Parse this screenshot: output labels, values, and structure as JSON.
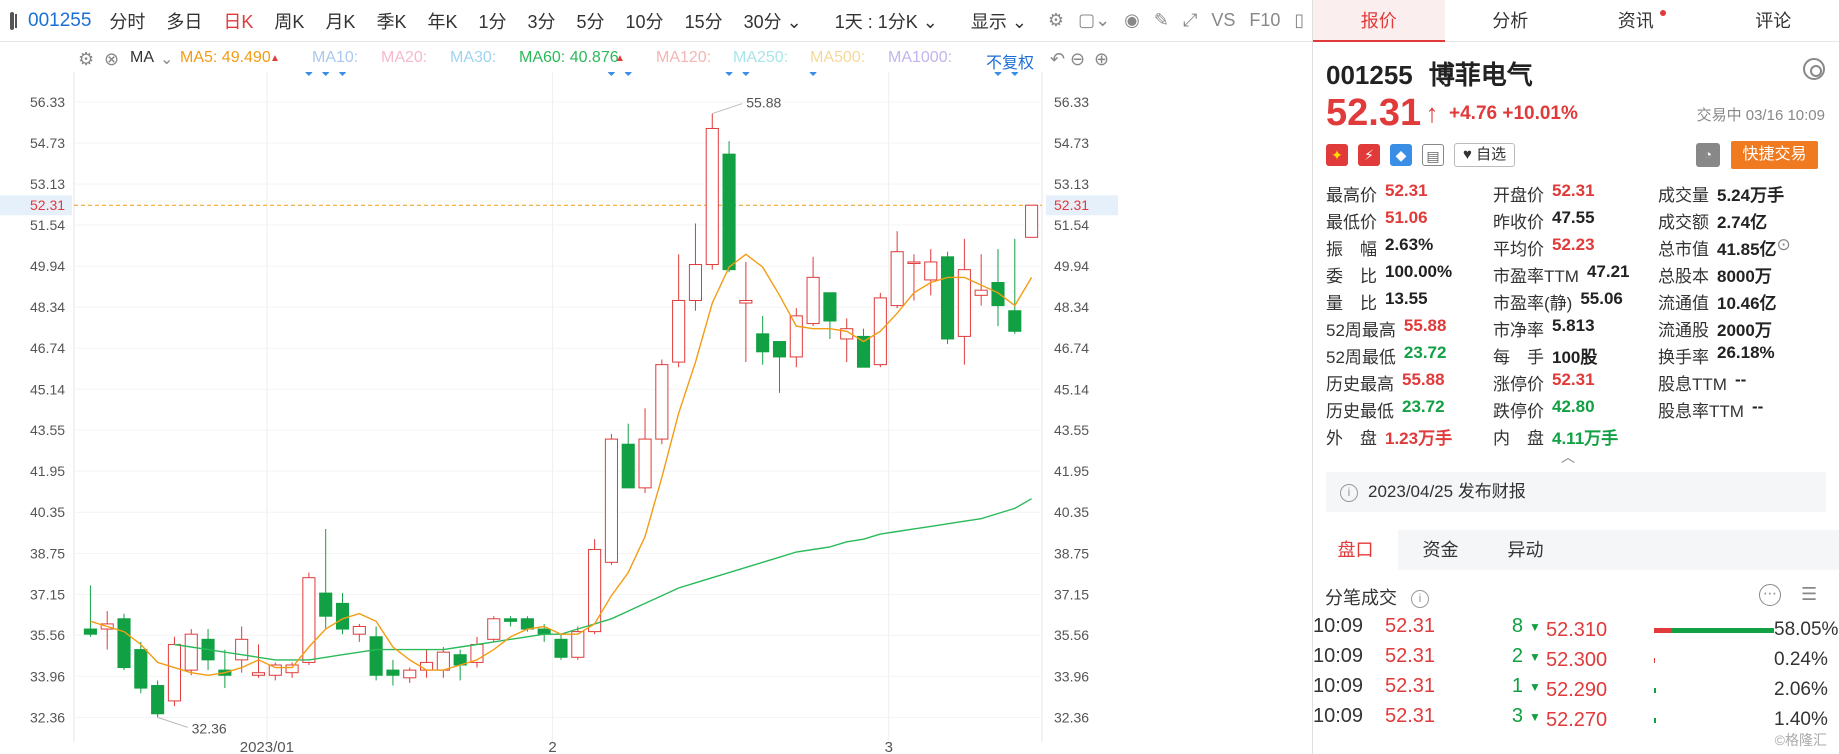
{
  "toolbar": {
    "code": "001255",
    "periods": [
      "分时",
      "多日",
      "日K",
      "周K",
      "月K",
      "季K",
      "年K",
      "1分",
      "3分",
      "5分",
      "10分",
      "15分",
      "30分 ⌄"
    ],
    "active_index": 2,
    "range": "1天 : 1分K ⌄",
    "display": "显示 ⌄",
    "tools": [
      "gear-icon",
      "square-icon",
      "camera-icon",
      "pen-icon",
      "expand-icon",
      "vs-icon",
      "f10-icon",
      "sidebar-icon"
    ],
    "tool_labels": {
      "vs": "VS",
      "f10": "F10"
    }
  },
  "ma_row": {
    "ma_label": "MA",
    "ma5": "MA5: 49.490",
    "ma10": "MA10:",
    "ma20": "MA20:",
    "ma30": "MA30:",
    "ma60": "MA60: 40.876",
    "ma120": "MA120:",
    "ma250": "MA250:",
    "ma500": "MA500:",
    "ma1000": "MA1000:",
    "adjust": "不复权"
  },
  "colors": {
    "up": "#e03a3a",
    "down": "#11a043",
    "ma5": "#f39c12",
    "ma60": "#2bba5a",
    "accent": "#1a6fd6",
    "ma10": "#aac8ee",
    "ma20": "#f5b8cf",
    "ma30": "#9fd4ee",
    "ma120": "#f4b5b5",
    "ma250": "#a8e5e8",
    "ma500": "#f7d89b",
    "ma1000": "#c3b4ee"
  },
  "chart_data": {
    "type": "candlestick",
    "x_tick_labels": [
      "2023/01",
      "2",
      "3"
    ],
    "y_tick_labels": [
      "56.33",
      "54.73",
      "53.13",
      "51.54",
      "49.94",
      "48.34",
      "46.74",
      "45.14",
      "43.55",
      "41.95",
      "40.35",
      "38.75",
      "37.15",
      "35.56",
      "33.96",
      "32.36"
    ],
    "ylim": [
      31.4,
      57.5
    ],
    "last_price_label": "52.31",
    "high_annotation": "55.88",
    "low_annotation": "32.36",
    "candles": [
      {
        "o": 35.8,
        "h": 37.5,
        "l": 35.5,
        "c": 35.6
      },
      {
        "o": 35.8,
        "h": 36.5,
        "l": 35.0,
        "c": 36.0
      },
      {
        "o": 36.2,
        "h": 36.4,
        "l": 34.2,
        "c": 34.3
      },
      {
        "o": 35.0,
        "h": 35.3,
        "l": 33.3,
        "c": 33.5
      },
      {
        "o": 33.6,
        "h": 33.8,
        "l": 32.36,
        "c": 32.5
      },
      {
        "o": 33.0,
        "h": 35.5,
        "l": 32.8,
        "c": 35.2
      },
      {
        "o": 34.2,
        "h": 35.8,
        "l": 34.0,
        "c": 35.6
      },
      {
        "o": 35.4,
        "h": 35.8,
        "l": 34.2,
        "c": 34.6
      },
      {
        "o": 34.2,
        "h": 35.0,
        "l": 33.5,
        "c": 34.0
      },
      {
        "o": 34.6,
        "h": 35.9,
        "l": 34.1,
        "c": 35.4
      },
      {
        "o": 34.0,
        "h": 35.2,
        "l": 33.9,
        "c": 34.1
      },
      {
        "o": 34.0,
        "h": 34.5,
        "l": 33.8,
        "c": 34.4
      },
      {
        "o": 34.1,
        "h": 34.5,
        "l": 33.9,
        "c": 34.4
      },
      {
        "o": 34.5,
        "h": 38.0,
        "l": 34.4,
        "c": 37.8
      },
      {
        "o": 37.2,
        "h": 39.7,
        "l": 35.8,
        "c": 36.3
      },
      {
        "o": 36.8,
        "h": 37.2,
        "l": 35.6,
        "c": 35.8
      },
      {
        "o": 35.6,
        "h": 36.0,
        "l": 35.3,
        "c": 35.9
      },
      {
        "o": 35.5,
        "h": 35.9,
        "l": 33.8,
        "c": 34.0
      },
      {
        "o": 34.2,
        "h": 34.6,
        "l": 33.6,
        "c": 34.0
      },
      {
        "o": 33.9,
        "h": 34.3,
        "l": 33.7,
        "c": 34.2
      },
      {
        "o": 34.2,
        "h": 35.0,
        "l": 33.9,
        "c": 34.5
      },
      {
        "o": 34.2,
        "h": 35.1,
        "l": 33.9,
        "c": 34.9
      },
      {
        "o": 34.8,
        "h": 35.0,
        "l": 33.8,
        "c": 34.4
      },
      {
        "o": 34.5,
        "h": 35.5,
        "l": 34.3,
        "c": 35.2
      },
      {
        "o": 35.4,
        "h": 36.3,
        "l": 35.3,
        "c": 36.2
      },
      {
        "o": 36.2,
        "h": 36.3,
        "l": 35.9,
        "c": 36.1
      },
      {
        "o": 36.2,
        "h": 36.3,
        "l": 35.7,
        "c": 35.8
      },
      {
        "o": 35.8,
        "h": 36.0,
        "l": 35.3,
        "c": 35.6
      },
      {
        "o": 35.4,
        "h": 35.6,
        "l": 34.6,
        "c": 34.7
      },
      {
        "o": 34.7,
        "h": 35.9,
        "l": 34.6,
        "c": 35.7
      },
      {
        "o": 35.7,
        "h": 39.3,
        "l": 35.6,
        "c": 38.9
      },
      {
        "o": 38.4,
        "h": 43.4,
        "l": 38.3,
        "c": 43.2
      },
      {
        "o": 43.0,
        "h": 43.8,
        "l": 41.6,
        "c": 41.3
      },
      {
        "o": 41.3,
        "h": 44.4,
        "l": 41.1,
        "c": 43.2
      },
      {
        "o": 43.2,
        "h": 46.3,
        "l": 43.0,
        "c": 46.1
      },
      {
        "o": 46.2,
        "h": 50.4,
        "l": 46.0,
        "c": 48.6
      },
      {
        "o": 48.6,
        "h": 51.6,
        "l": 48.2,
        "c": 50.0
      },
      {
        "o": 50.0,
        "h": 55.88,
        "l": 49.8,
        "c": 55.3
      },
      {
        "o": 54.3,
        "h": 54.8,
        "l": 49.7,
        "c": 49.8
      },
      {
        "o": 48.5,
        "h": 50.1,
        "l": 46.2,
        "c": 48.6
      },
      {
        "o": 47.3,
        "h": 48.0,
        "l": 46.1,
        "c": 46.6
      },
      {
        "o": 47.0,
        "h": 47.0,
        "l": 45.0,
        "c": 46.4
      },
      {
        "o": 46.4,
        "h": 48.3,
        "l": 46.0,
        "c": 48.0
      },
      {
        "o": 47.7,
        "h": 50.3,
        "l": 47.6,
        "c": 49.5
      },
      {
        "o": 48.9,
        "h": 48.9,
        "l": 47.1,
        "c": 47.8
      },
      {
        "o": 47.1,
        "h": 47.9,
        "l": 46.2,
        "c": 47.5
      },
      {
        "o": 47.2,
        "h": 47.5,
        "l": 46.1,
        "c": 46.0
      },
      {
        "o": 46.1,
        "h": 48.9,
        "l": 46.0,
        "c": 48.7
      },
      {
        "o": 48.4,
        "h": 51.3,
        "l": 48.3,
        "c": 50.5
      },
      {
        "o": 50.1,
        "h": 50.4,
        "l": 48.6,
        "c": 50.1
      },
      {
        "o": 49.4,
        "h": 50.6,
        "l": 48.8,
        "c": 50.1
      },
      {
        "o": 50.3,
        "h": 50.5,
        "l": 46.9,
        "c": 47.1
      },
      {
        "o": 47.2,
        "h": 51.0,
        "l": 46.1,
        "c": 49.8
      },
      {
        "o": 48.8,
        "h": 50.4,
        "l": 48.4,
        "c": 49.0
      },
      {
        "o": 49.3,
        "h": 50.6,
        "l": 47.6,
        "c": 48.4
      },
      {
        "o": 48.2,
        "h": 51.0,
        "l": 47.3,
        "c": 47.4
      },
      {
        "o": 51.06,
        "h": 52.31,
        "l": 51.06,
        "c": 52.31
      }
    ],
    "ma5": [
      36.1,
      35.9,
      35.7,
      35.2,
      34.5,
      34.3,
      34.1,
      34.0,
      34.1,
      34.3,
      34.6,
      34.3,
      34.3,
      35.1,
      35.8,
      36.2,
      36.4,
      36.1,
      35.1,
      34.6,
      34.2,
      34.2,
      34.4,
      34.6,
      35.0,
      35.5,
      35.8,
      35.9,
      35.6,
      35.6,
      36.0,
      37.1,
      38.0,
      39.4,
      41.7,
      44.2,
      46.2,
      48.5,
      49.9,
      50.4,
      49.9,
      48.8,
      47.6,
      47.5,
      47.5,
      47.4,
      47.0,
      47.4,
      48.1,
      48.9,
      49.3,
      49.5,
      49.5,
      49.2,
      48.9,
      48.4,
      49.5
    ],
    "ma60": [
      null,
      null,
      null,
      null,
      null,
      35.2,
      35.1,
      35.0,
      34.9,
      34.8,
      34.7,
      34.6,
      34.6,
      34.6,
      34.7,
      34.8,
      34.9,
      35.0,
      35.0,
      35.0,
      35.0,
      35.0,
      35.1,
      35.2,
      35.3,
      35.4,
      35.5,
      35.6,
      35.6,
      35.8,
      36.0,
      36.2,
      36.5,
      36.8,
      37.1,
      37.4,
      37.6,
      37.8,
      38.0,
      38.2,
      38.4,
      38.6,
      38.8,
      38.9,
      39.0,
      39.2,
      39.3,
      39.5,
      39.6,
      39.7,
      39.8,
      39.9,
      40.0,
      40.1,
      40.3,
      40.5,
      40.876
    ]
  },
  "panel": {
    "tabs": [
      "报价",
      "分析",
      "资讯",
      "评论"
    ],
    "code": "001255",
    "name": "博菲电气",
    "price": "52.31",
    "arrow": "↑",
    "change": "+4.76",
    "change_pct": "+10.01%",
    "status": "交易中 03/16 10:09",
    "watchlist": "♥ 自选",
    "bell": "◔",
    "quick_trade": "快捷交易",
    "badges": [
      "✦",
      "⚡",
      "◆",
      "▤"
    ],
    "stats": [
      [
        [
          "最高价",
          "52.31",
          "red"
        ],
        [
          "开盘价",
          "52.31",
          "red"
        ],
        [
          "成交量",
          "5.24万手",
          "blk"
        ]
      ],
      [
        [
          "最低价",
          "51.06",
          "red"
        ],
        [
          "昨收价",
          "47.55",
          "blk"
        ],
        [
          "成交额",
          "2.74亿",
          "blk"
        ]
      ],
      [
        [
          "振　幅",
          "2.63%",
          "blk"
        ],
        [
          "平均价",
          "52.23",
          "red"
        ],
        [
          "总市值",
          "41.85亿",
          "blk"
        ]
      ],
      [
        [
          "委　比",
          "100.00%",
          "blk"
        ],
        [
          "市盈率TTM",
          "47.21",
          "blk"
        ],
        [
          "总股本",
          "8000万",
          "blk"
        ]
      ],
      [
        [
          "量　比",
          "13.55",
          "blk"
        ],
        [
          "市盈率(静)",
          "55.06",
          "blk"
        ],
        [
          "流通值",
          "10.46亿",
          "blk"
        ]
      ],
      [
        [
          "52周最高",
          "55.88",
          "red"
        ],
        [
          "市净率",
          "5.813",
          "blk"
        ],
        [
          "流通股",
          "2000万",
          "blk"
        ]
      ],
      [
        [
          "52周最低",
          "23.72",
          "green"
        ],
        [
          "每　手",
          "100股",
          "blk"
        ],
        [
          "换手率",
          "26.18%",
          "blk"
        ]
      ],
      [
        [
          "历史最高",
          "55.88",
          "red"
        ],
        [
          "涨停价",
          "52.31",
          "red"
        ],
        [
          "股息TTM",
          "--",
          "blk"
        ]
      ],
      [
        [
          "历史最低",
          "23.72",
          "green"
        ],
        [
          "跌停价",
          "42.80",
          "green"
        ],
        [
          "股息率TTM",
          "--",
          "blk"
        ]
      ],
      [
        [
          "外　盘",
          "1.23万手",
          "red"
        ],
        [
          "内　盘",
          "4.11万手",
          "green"
        ]
      ]
    ],
    "expand": "︿",
    "report": "2023/04/25  发布财报",
    "subtabs": [
      "盘口",
      "资金",
      "异动"
    ],
    "trades_title": "分笔成交",
    "trades": [
      {
        "time": "10:09",
        "price": "52.31",
        "vol": "8"
      },
      {
        "time": "10:09",
        "price": "52.31",
        "vol": "2"
      },
      {
        "time": "10:09",
        "price": "52.31",
        "vol": "1"
      },
      {
        "time": "10:09",
        "price": "52.31",
        "vol": "3"
      }
    ],
    "levels": [
      {
        "price": "52.310",
        "pct": "58.05%",
        "red": 0.15,
        "green": 0.85
      },
      {
        "price": "52.300",
        "pct": "0.24%",
        "red": 0.01,
        "green": 0.0
      },
      {
        "price": "52.290",
        "pct": "2.06%",
        "red": 0.0,
        "green": 0.02
      },
      {
        "price": "52.270",
        "pct": "1.40%",
        "red": 0.0,
        "green": 0.015
      }
    ],
    "watermark": "©格隆汇"
  }
}
